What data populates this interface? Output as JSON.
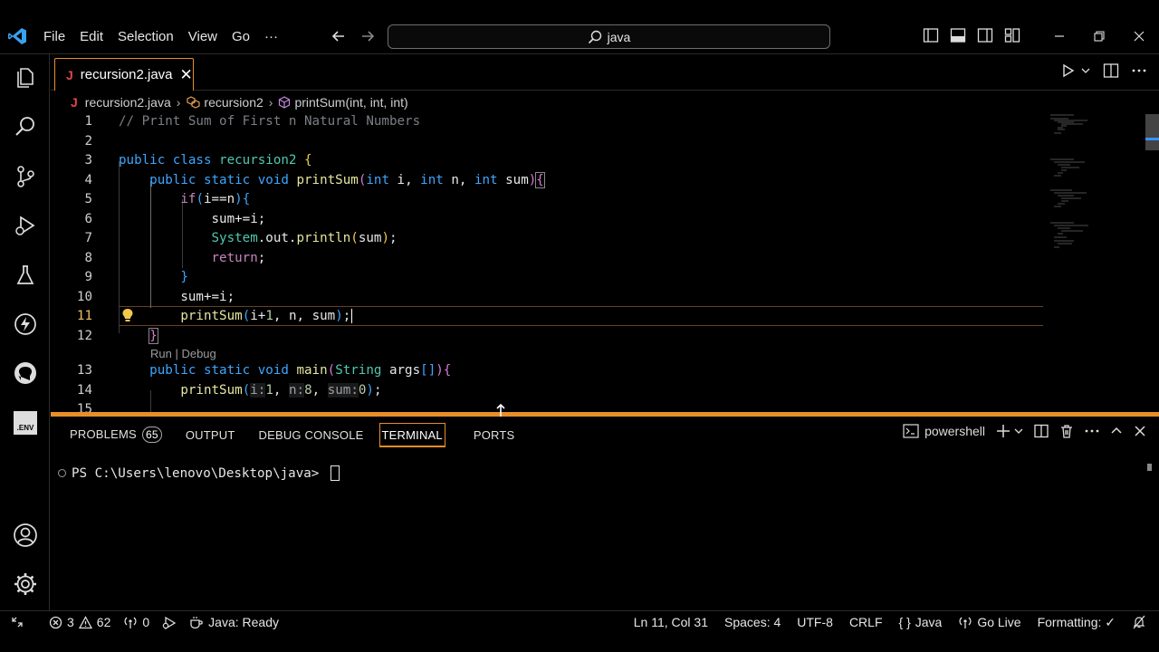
{
  "titlebar": {
    "menu": [
      "File",
      "Edit",
      "Selection",
      "View",
      "Go",
      "···"
    ],
    "search_text": "java"
  },
  "tab": {
    "icon_letter": "J",
    "name": "recursion2.java",
    "close": "✕"
  },
  "breadcrumb": {
    "file": "recursion2.java",
    "class": "recursion2",
    "method": "printSum(int, int, int)"
  },
  "editor": {
    "line_numbers": [
      "1",
      "2",
      "3",
      "4",
      "5",
      "6",
      "7",
      "8",
      "9",
      "10",
      "11",
      "12",
      "13",
      "14",
      "15"
    ],
    "active_line": "11",
    "comment": "// Print Sum of First n Natural Numbers",
    "codelens": "Run | Debug"
  },
  "panel": {
    "tabs": [
      "PROBLEMS",
      "OUTPUT",
      "DEBUG CONSOLE",
      "TERMINAL",
      "PORTS"
    ],
    "problems_count": "65",
    "shell": "powershell",
    "prompt": "PS C:\\Users\\lenovo\\Desktop\\java> "
  },
  "statusbar": {
    "errors": "3",
    "warnings": "62",
    "ports": "0",
    "java_status": "Java: Ready",
    "position": "Ln 11, Col 31",
    "spaces": "Spaces: 4",
    "encoding": "UTF-8",
    "eol": "CRLF",
    "language": "Java",
    "golive": "Go Live",
    "formatting": "Formatting: ✓"
  },
  "activity": {
    "env_label": ".ENV"
  },
  "colors": {
    "accent": "#e88e28",
    "keyword": "#3ea6ff",
    "function": "#e6e6a0",
    "comment": "#7b7f86"
  }
}
